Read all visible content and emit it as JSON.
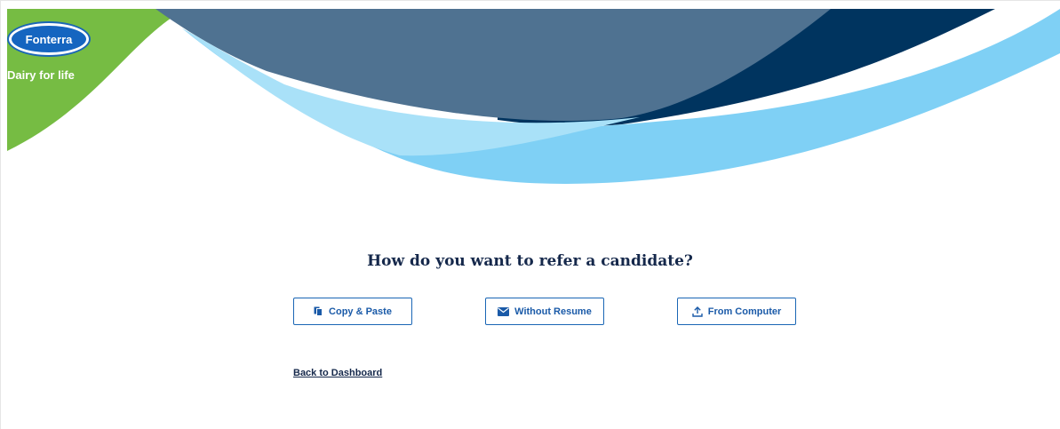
{
  "brand": {
    "logo_text": "Fonterra",
    "tagline": "Dairy for life",
    "colors": {
      "green": "#76bc43",
      "dark_navy": "#00345f",
      "slate_blue": "#4f7291",
      "light_blue": "#7fd0f5",
      "pale_blue": "#a9e1f8"
    }
  },
  "main": {
    "question": "How do you want to refer a candidate?",
    "options": [
      {
        "label": "Copy & Paste",
        "icon": "copy-icon"
      },
      {
        "label": "Without Resume",
        "icon": "envelope-icon"
      },
      {
        "label": "From Computer",
        "icon": "upload-icon"
      }
    ],
    "back_link": "Back to Dashboard"
  },
  "colors": {
    "button_border": "#1a66b5",
    "button_text": "#1a5aa8",
    "heading_text": "#15284b"
  }
}
